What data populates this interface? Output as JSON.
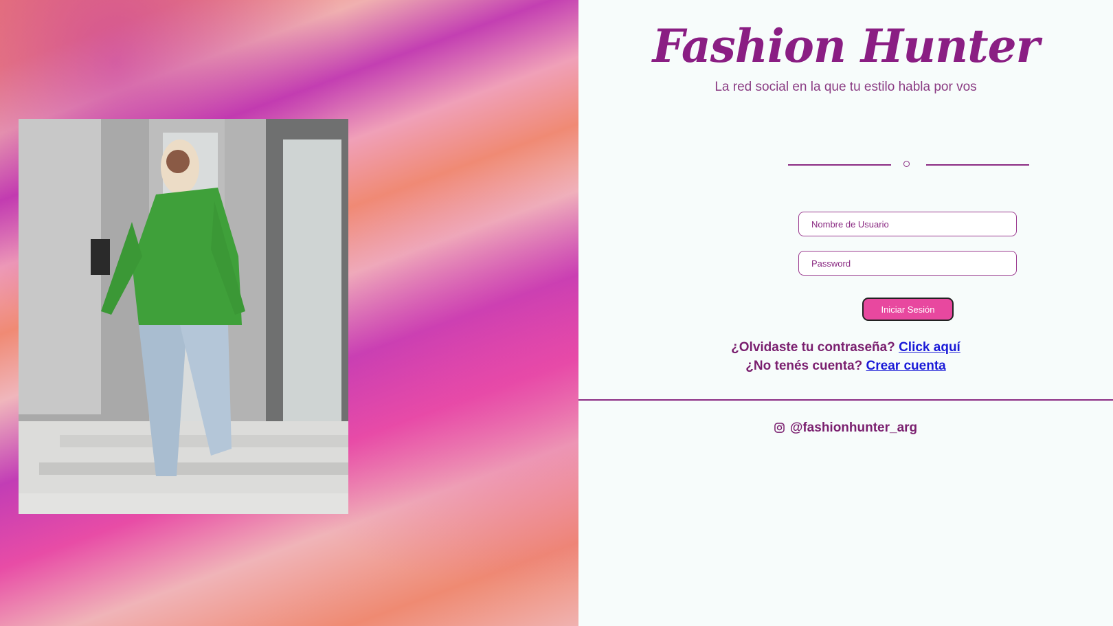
{
  "brand": {
    "name": "Fashion Hunter",
    "tagline": "La red social en la que tu estilo habla por vos"
  },
  "form": {
    "username_placeholder": "Nombre de Usuario",
    "password_placeholder": "Password",
    "login_label": "Iniciar Sesión"
  },
  "help": {
    "forgot_text": "¿Olvidaste tu contraseña?",
    "forgot_link": "Click aquí",
    "signup_text": "¿No tenés cuenta?",
    "signup_link": "Crear cuenta"
  },
  "social": {
    "instagram_handle": "@fashionhunter_arg",
    "icon": "instagram-icon"
  },
  "colors": {
    "accent": "#8a1e83",
    "button": "#e8489f",
    "link": "#1a1ad8"
  }
}
